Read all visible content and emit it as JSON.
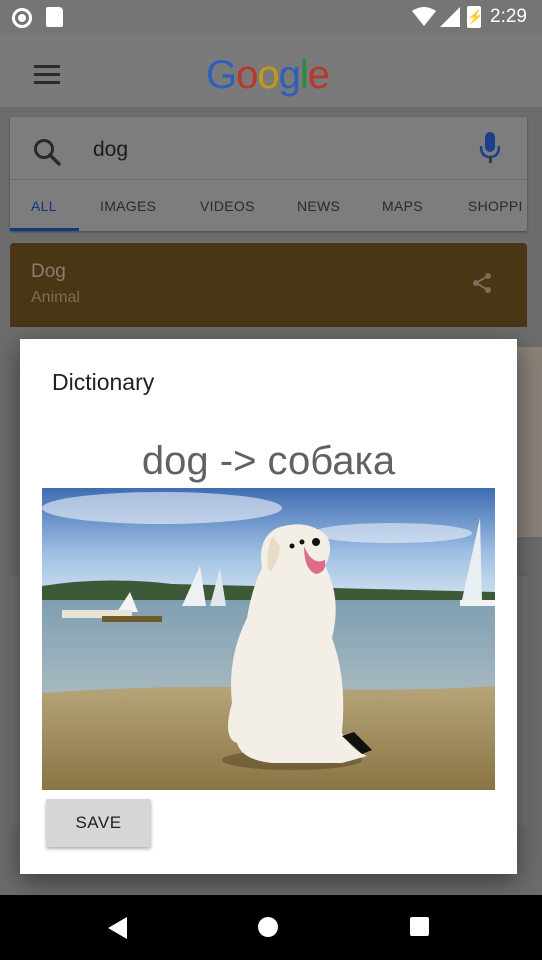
{
  "status_bar": {
    "time": "2:29"
  },
  "app_bar": {
    "logo": [
      "G",
      "o",
      "o",
      "g",
      "l",
      "e"
    ]
  },
  "search": {
    "query": "dog",
    "tabs": [
      "ALL",
      "IMAGES",
      "VIDEOS",
      "NEWS",
      "MAPS",
      "SHOPPI"
    ]
  },
  "knowledge_panel": {
    "title": "Dog",
    "subtitle": "Animal"
  },
  "dialog": {
    "title": "Dictionary",
    "translation": "dog -> собака",
    "save_label": "SAVE"
  },
  "colors": {
    "logo_blue": "#2f5fb8",
    "logo_red": "#b8382c",
    "logo_yellow": "#c29a18",
    "logo_green": "#2e8a3e",
    "accent_blue": "#0d3a7a",
    "panel_brown": "#4a3515"
  }
}
